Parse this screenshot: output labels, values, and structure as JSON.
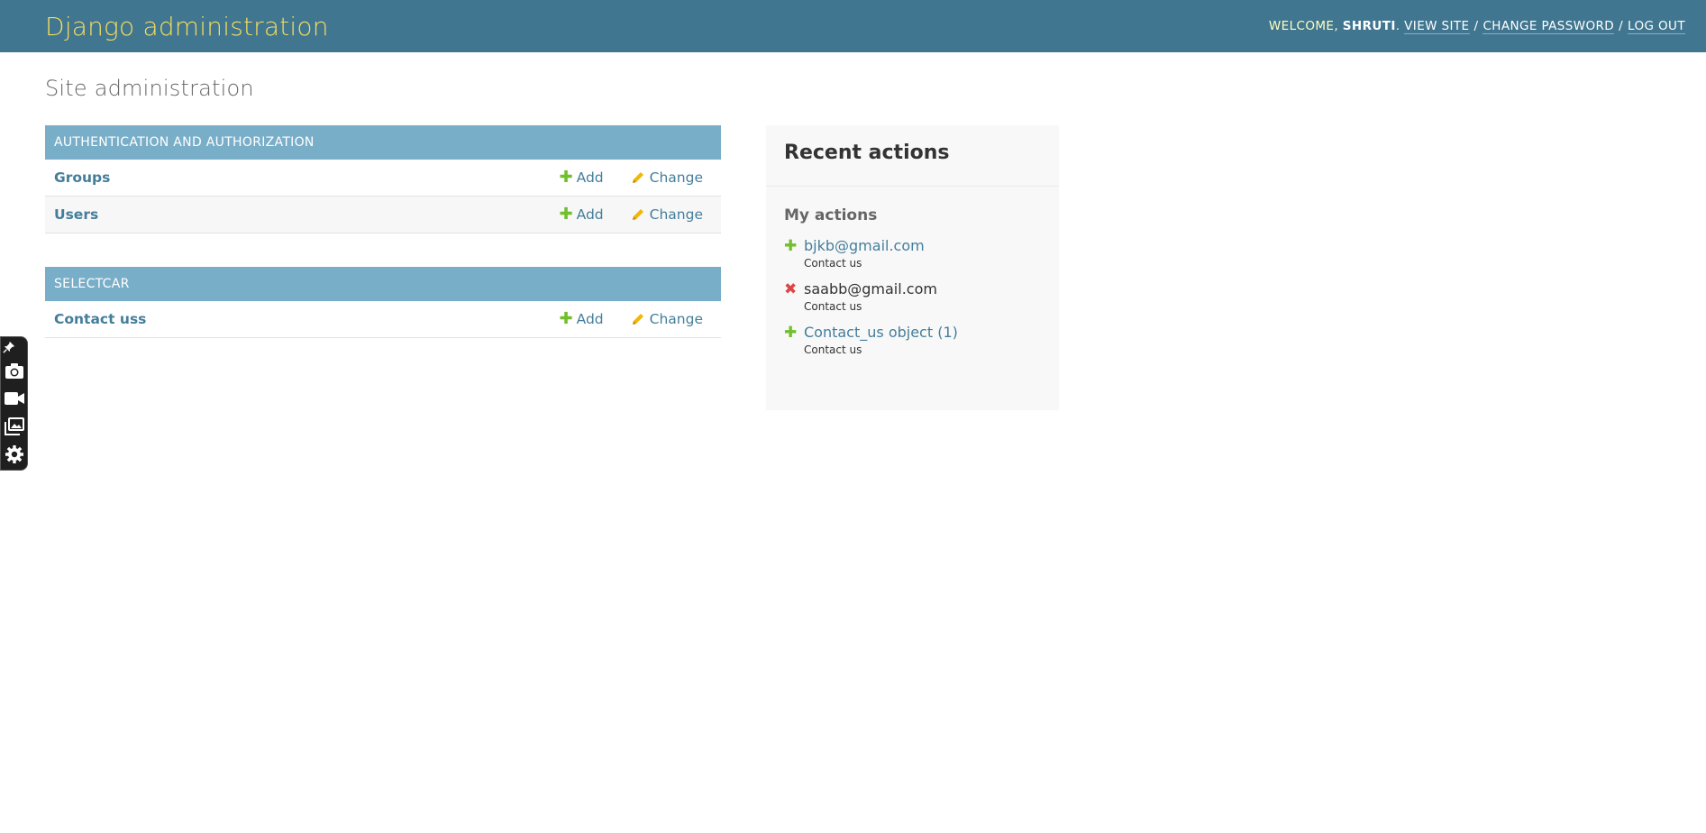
{
  "header": {
    "brand": "Django administration",
    "welcome": "WELCOME,",
    "username": "SHRUTI",
    "username_suffix": ".",
    "view_site": "VIEW SITE",
    "change_password": "CHANGE PASSWORD",
    "log_out": "LOG OUT",
    "separator": "/"
  },
  "page_title": "Site administration",
  "apps": [
    {
      "caption": "AUTHENTICATION AND AUTHORIZATION",
      "models": [
        {
          "name": "Groups",
          "add": "Add",
          "change": "Change"
        },
        {
          "name": "Users",
          "add": "Add",
          "change": "Change"
        }
      ]
    },
    {
      "caption": "SELECTCAR",
      "models": [
        {
          "name": "Contact uss",
          "add": "Add",
          "change": "Change"
        }
      ]
    }
  ],
  "recent_actions": {
    "title": "Recent actions",
    "subtitle": "My actions",
    "items": [
      {
        "type": "add",
        "object": "bjkb@gmail.com",
        "content_type": "Contact us"
      },
      {
        "type": "delete",
        "object": "saabb@gmail.com",
        "content_type": "Contact us"
      },
      {
        "type": "add",
        "object": "Contact_us object (1)",
        "content_type": "Contact us"
      }
    ]
  },
  "icons": {
    "add": "plus-icon",
    "change": "pencil-icon",
    "delete": "x-icon",
    "widget": [
      "pin-icon",
      "camera-icon",
      "video-camera-icon",
      "gallery-icon",
      "gear-icon"
    ]
  },
  "colors": {
    "header_bg": "#417690",
    "brand": "#f5dd5d",
    "module_caption_bg": "#79aec8",
    "link": "#447e9b",
    "add_green": "#70bf2b",
    "delete_red": "#dd4646",
    "change_yellow": "#efb80b"
  }
}
